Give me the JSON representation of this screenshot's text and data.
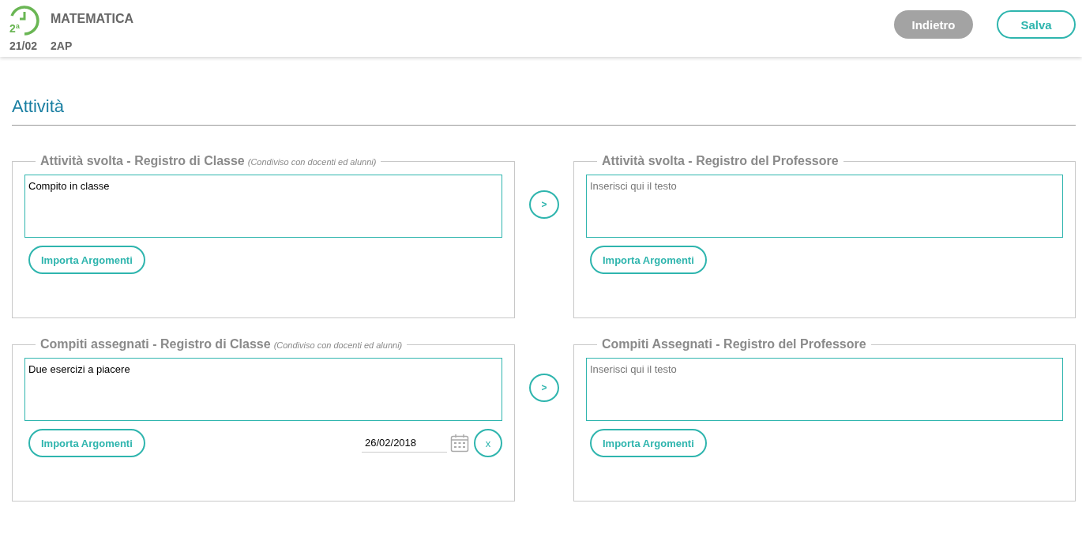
{
  "header": {
    "hour_badge": "2ª",
    "date": "21/02",
    "subject": "MATEMATICA",
    "class": "2AP",
    "buttons": [
      {
        "label": "Indietro",
        "kind": "secondary"
      },
      {
        "label": "Salva",
        "kind": "primary"
      }
    ]
  },
  "section_title": "Attività",
  "rows": [
    {
      "left": {
        "legend": "Attività svolta - Registro di Classe",
        "note": "(Condiviso con docenti ed alunni)",
        "value": "Compito in classe",
        "import_button": "Importa Argomenti"
      },
      "copy_button": ">",
      "right": {
        "legend": "Attività svolta - Registro del Professore",
        "placeholder": "Inserisci qui il testo",
        "import_button": "Importa Argomenti"
      }
    },
    {
      "left": {
        "legend": "Compiti assegnati - Registro di Classe",
        "note": "(Condiviso con docenti ed alunni)",
        "value": "Due esercizi a piacere",
        "import_button": "Importa Argomenti",
        "due_date": "26/02/2018",
        "clear_button": "x"
      },
      "copy_button": ">",
      "right": {
        "legend": "Compiti Assegnati - Registro del Professore",
        "placeholder": "Inserisci qui il testo",
        "import_button": "Importa Argomenti"
      }
    }
  ]
}
